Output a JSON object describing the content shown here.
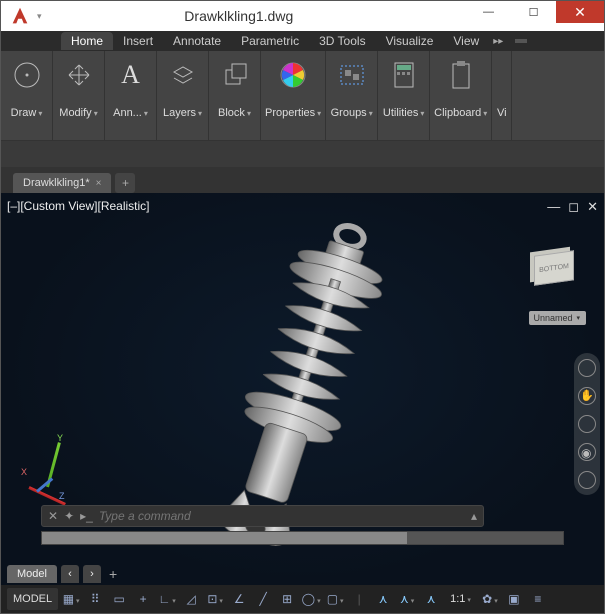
{
  "titlebar": {
    "title": "Drawklkling1.dwg"
  },
  "menu": {
    "items": [
      "Home",
      "Insert",
      "Annotate",
      "Parametric",
      "3D Tools",
      "Visualize",
      "View"
    ],
    "active_index": 0
  },
  "ribbon": {
    "panels": [
      {
        "label": "Draw",
        "icon": "circle"
      },
      {
        "label": "Modify",
        "icon": "move"
      },
      {
        "label": "Ann...",
        "icon": "text-a"
      },
      {
        "label": "Layers",
        "icon": "layers"
      },
      {
        "label": "Block",
        "icon": "block"
      },
      {
        "label": "Properties",
        "icon": "color-wheel"
      },
      {
        "label": "Groups",
        "icon": "group"
      },
      {
        "label": "Utilities",
        "icon": "calc"
      },
      {
        "label": "Clipboard",
        "icon": "clipboard"
      },
      {
        "label": "Vi",
        "icon": ""
      }
    ]
  },
  "doctab": {
    "label": "Drawklkling1*"
  },
  "viewport": {
    "label": "[–][Custom View][Realistic]",
    "cube_face": "BOTTOM",
    "unnamed": "Unnamed",
    "axes": {
      "x": "X",
      "y": "Y",
      "z": "Z"
    }
  },
  "command": {
    "placeholder": "Type a command"
  },
  "model_tab": {
    "label": "Model"
  },
  "status": {
    "model_btn": "MODEL",
    "scale": "1:1",
    "items": [
      "grid",
      "dots",
      "snap",
      "plus",
      "angle",
      "perp",
      "osnap",
      "slash",
      "dim",
      "circle",
      "box"
    ],
    "right_items": [
      "walk",
      "person",
      "person2",
      "scale",
      "gear",
      "full",
      "menu"
    ]
  }
}
